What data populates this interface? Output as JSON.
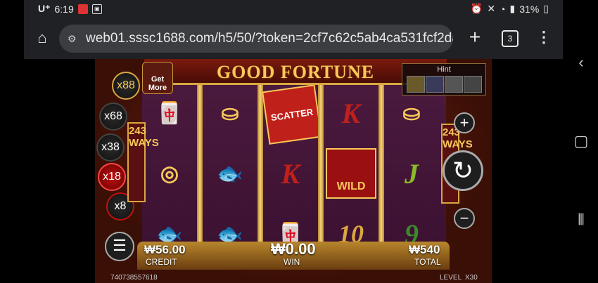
{
  "status": {
    "carrier": "U⁺",
    "time": "6:19",
    "battery": "31%"
  },
  "browser": {
    "url": "web01.sssc1688.com/h5/50/?token=2cf7c62c5ab4ca531fcf2da",
    "tab_count": "3"
  },
  "game": {
    "title": "GOOD FORTUNE",
    "get_more": "Get More",
    "hint_label": "Hint",
    "multipliers": [
      "x88",
      "x68",
      "x38",
      "x18",
      "x8"
    ],
    "ways_left": "243 WAYS",
    "ways_right": "243 WAYS",
    "symbols": {
      "scatter": "SCATTER",
      "wild": "WILD",
      "k": "K",
      "j": "J",
      "ten": "10",
      "nine": "9"
    },
    "credit_value": "₩56.00",
    "credit_label": "CREDIT",
    "win_value": "₩0.00",
    "win_label": "WIN",
    "total_value": "₩540",
    "total_label": "TOTAL",
    "game_id": "740738557618",
    "level_label": "LEVEL",
    "level_value": "X30"
  }
}
